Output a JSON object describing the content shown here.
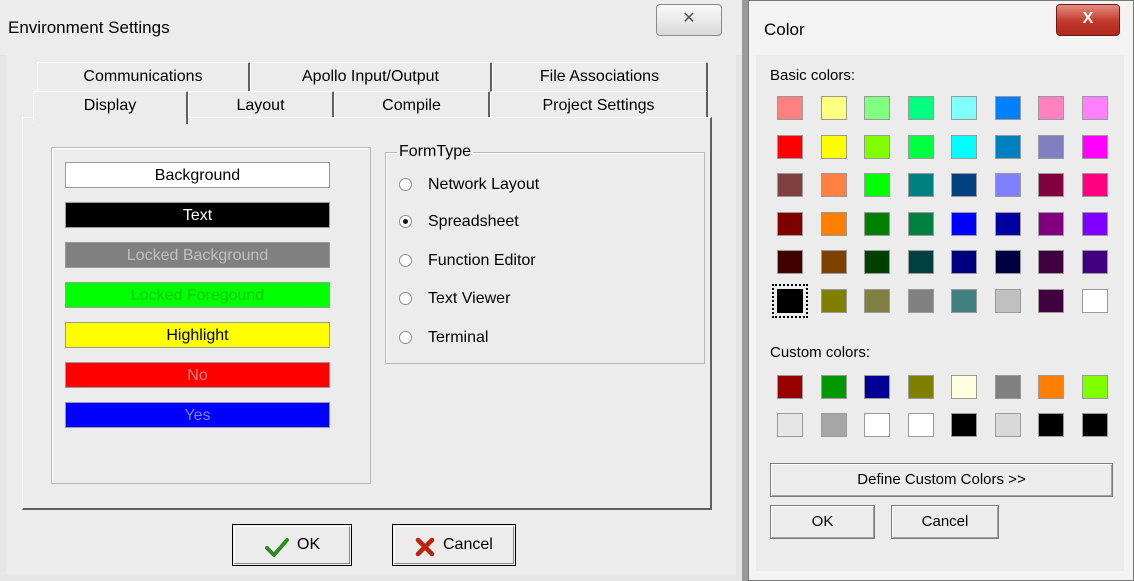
{
  "env": {
    "title": "Environment Settings",
    "close_glyph": "✕",
    "tabs_back": [
      "Communications",
      "Apollo Input/Output",
      "File Associations"
    ],
    "tabs_front": [
      "Display",
      "Layout",
      "Compile",
      "Project Settings"
    ],
    "active_tab": "Display",
    "color_items": [
      {
        "label": "Background",
        "bg": "#ffffff",
        "fg": "#000000"
      },
      {
        "label": "Text",
        "bg": "#000000",
        "fg": "#ffffff"
      },
      {
        "label": "Locked Background",
        "bg": "#808080",
        "fg": "#c0c0c0"
      },
      {
        "label": "Locked Foregound",
        "bg": "#00ff00",
        "fg": "#00cc00"
      },
      {
        "label": "Highlight",
        "bg": "#ffff00",
        "fg": "#000000"
      },
      {
        "label": "No",
        "bg": "#ff0000",
        "fg": "#ff8080"
      },
      {
        "label": "Yes",
        "bg": "#0000ff",
        "fg": "#8080ff"
      }
    ],
    "formtype": {
      "legend": "FormType",
      "options": [
        "Network Layout",
        "Spreadsheet",
        "Function Editor",
        "Text Viewer",
        "Terminal"
      ],
      "selected": "Spreadsheet"
    },
    "ok_label": "OK",
    "cancel_label": "Cancel",
    "ok_icon": "checkmark-icon",
    "cancel_icon": "x-mark-icon"
  },
  "color_dialog": {
    "title": "Color",
    "close_glyph": "X",
    "basic_label": "Basic colors:",
    "custom_label": "Custom colors:",
    "basic_colors": [
      [
        "#ff8080",
        "#ffff80",
        "#80ff80",
        "#00ff80",
        "#80ffff",
        "#0080ff",
        "#ff80c0",
        "#ff80ff"
      ],
      [
        "#ff0000",
        "#ffff00",
        "#80ff00",
        "#00ff40",
        "#00ffff",
        "#0080c0",
        "#8080c0",
        "#ff00ff"
      ],
      [
        "#804040",
        "#ff8040",
        "#00ff00",
        "#008080",
        "#004080",
        "#8080ff",
        "#800040",
        "#ff0080"
      ],
      [
        "#800000",
        "#ff8000",
        "#008000",
        "#008040",
        "#0000ff",
        "#0000a0",
        "#800080",
        "#8000ff"
      ],
      [
        "#400000",
        "#804000",
        "#004000",
        "#004040",
        "#000080",
        "#000040",
        "#400040",
        "#400080"
      ],
      [
        "#000000",
        "#808000",
        "#808040",
        "#808080",
        "#408080",
        "#c0c0c0",
        "#400040",
        "#ffffff"
      ]
    ],
    "selected_basic": "#000000",
    "custom_colors": [
      [
        "#990000",
        "#009900",
        "#000099",
        "#808000",
        "#ffffe0",
        "#808080",
        "#ff8000",
        "#80ff00"
      ],
      [
        "#e6e6e6",
        "#a6a6a6",
        "#ffffff",
        "#ffffff",
        "#000000",
        "#d9d9d9",
        "#000000",
        "#000000"
      ]
    ],
    "define_label": "Define Custom Colors >>",
    "ok_label": "OK",
    "cancel_label": "Cancel"
  }
}
